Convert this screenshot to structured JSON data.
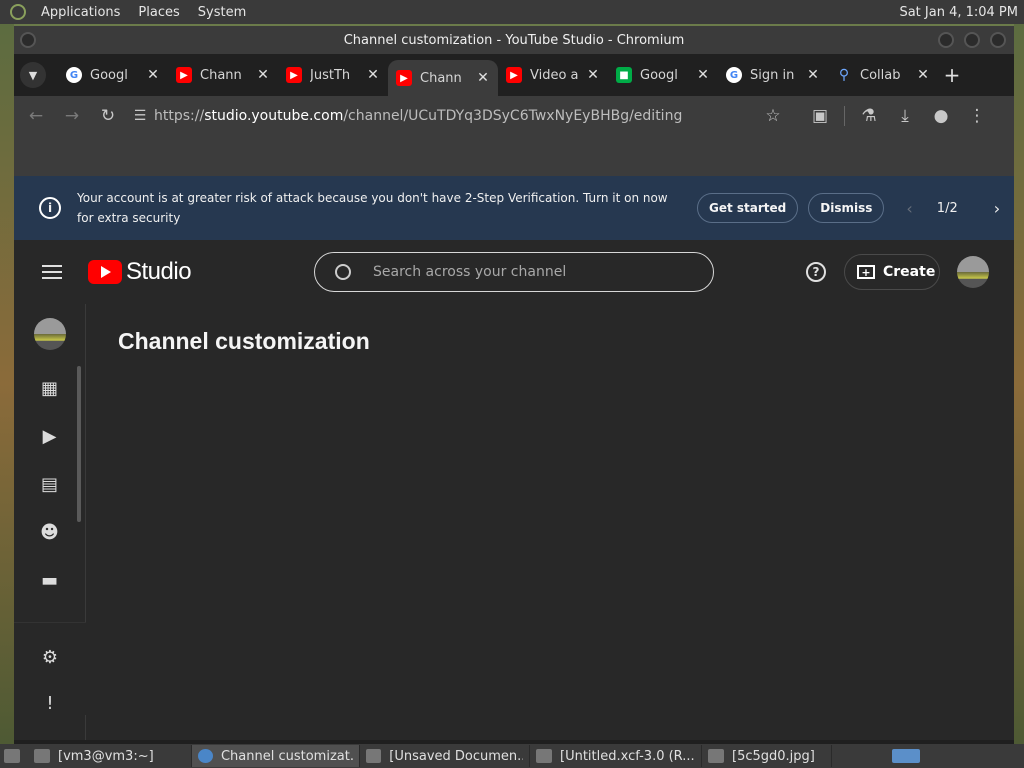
{
  "desktop": {
    "menus": [
      "Applications",
      "Places",
      "System"
    ],
    "clock": "Sat Jan  4,  1:04 PM"
  },
  "window": {
    "title": "Channel customization - YouTube Studio - Chromium"
  },
  "tabs": [
    {
      "title": "Googl",
      "icon": "google-icon"
    },
    {
      "title": "Chann",
      "icon": "youtube-icon"
    },
    {
      "title": "JustTh",
      "icon": "youtube-icon"
    },
    {
      "title": "Chann",
      "icon": "youtube-icon",
      "active": true
    },
    {
      "title": "Video a",
      "icon": "youtube-icon"
    },
    {
      "title": "Googl",
      "icon": "google-meet-icon"
    },
    {
      "title": "Sign in",
      "icon": "google-icon"
    },
    {
      "title": "Collab",
      "icon": "search-icon"
    }
  ],
  "address": {
    "prefix": "https://",
    "host": "studio.youtube.com",
    "path": "/channel/UCuTDYq3DSyC6TwxNyEyBHBg/editing"
  },
  "banner": {
    "message": "Your account is at greater risk of attack because you don't have 2-Step Verification. Turn it on now for extra security",
    "get_started": "Get started",
    "dismiss": "Dismiss",
    "page_count": "1/2"
  },
  "studio": {
    "wordmark": "Studio",
    "search_placeholder": "Search across your channel",
    "create_label": "Create",
    "page_title": "Channel customization"
  },
  "taskbar": [
    {
      "label": "[vm3@vm3:~]"
    },
    {
      "label": "Channel customizat...",
      "active": true
    },
    {
      "label": "[Unsaved Documen..."
    },
    {
      "label": "[Untitled.xcf-3.0 (R..."
    },
    {
      "label": "[5c5gd0.jpg]"
    }
  ],
  "colors": {
    "banner_bg": "#263850",
    "studio_bg": "#282828",
    "youtube_red": "#ff0000"
  }
}
